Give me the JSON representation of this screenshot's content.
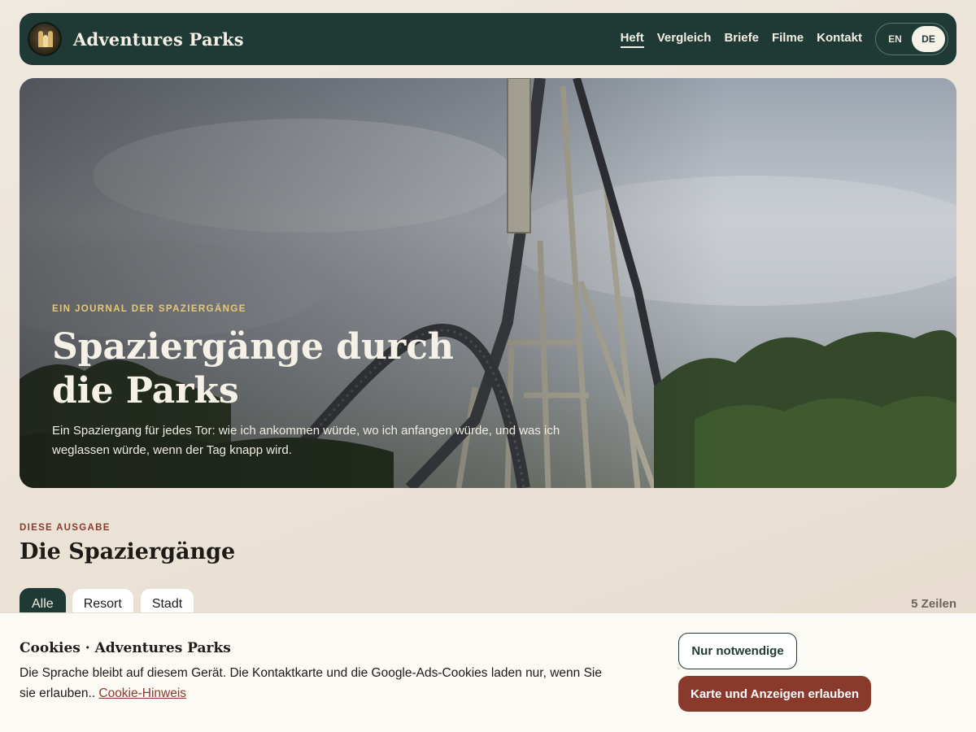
{
  "header": {
    "brand": "Adventures Parks",
    "logo_icon": "castle-gate-icon",
    "nav": [
      {
        "label": "Heft",
        "active": true
      },
      {
        "label": "Vergleich",
        "active": false
      },
      {
        "label": "Briefe",
        "active": false
      },
      {
        "label": "Filme",
        "active": false
      },
      {
        "label": "Kontakt",
        "active": false
      }
    ],
    "languages": {
      "en": "EN",
      "de": "DE",
      "selected": "DE"
    }
  },
  "hero": {
    "kicker": "EIN JOURNAL DER SPAZIERGÄNGE",
    "title": "Spaziergänge durch die Parks",
    "subtitle": "Ein Spaziergang für jedes Tor: wie ich ankommen würde, wo ich anfangen würde, und was ich weglassen würde, wenn der Tag knapp wird."
  },
  "section": {
    "kicker": "DIESE AUSGABE",
    "title": "Die Spaziergänge",
    "filters": [
      {
        "label": "Alle",
        "active": true
      },
      {
        "label": "Resort",
        "active": false
      },
      {
        "label": "Stadt",
        "active": false
      }
    ],
    "count": "5 Zeilen"
  },
  "cookie": {
    "title": "Cookies · Adventures Parks",
    "text": "Die Sprache bleibt auf diesem Gerät. Die Kontaktkarte und die Google-Ads-Cookies laden nur, wenn Sie sie erlauben..",
    "link": "Cookie-Hinweis",
    "btn_necessary": "Nur notwendige",
    "btn_allow": "Karte und Anzeigen erlauben"
  },
  "colors": {
    "header_bg": "#1f3a34",
    "accent_red": "#8a3a2c",
    "kicker_gold": "#e7c874",
    "page_bg": "#ebe2d6"
  }
}
